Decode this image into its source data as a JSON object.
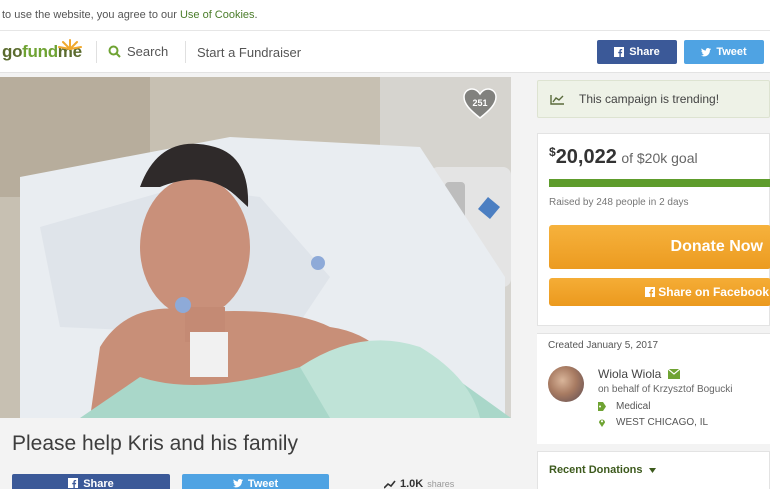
{
  "cookie_bar": {
    "text": "to use the website, you agree to our ",
    "link": "Use of Cookies",
    "period": "."
  },
  "header": {
    "logo_go": "go",
    "logo_fund": "fund",
    "logo_me": "me",
    "search_label": "Search",
    "start_label": "Start a Fundraiser",
    "share_label": "Share",
    "tweet_label": "Tweet"
  },
  "campaign": {
    "heart_count": "251",
    "title": "Please help Kris and his family",
    "share_label": "Share",
    "tweet_label": "Tweet",
    "shares_count": "1.0K",
    "shares_label": "shares"
  },
  "sidebar": {
    "trending": "This campaign is trending!",
    "currency": "$",
    "raised": "20,022",
    "goal": "of $20k goal",
    "progress_fraction": 1.0,
    "raised_by": "Raised by 248 people in 2 days",
    "donate_label": "Donate Now",
    "fb_share_label": "Share on Facebook",
    "created": "Created January 5, 2017",
    "organizer": "Wiola Wiola",
    "behalf": "on behalf of Krzysztof Bogucki",
    "category": "Medical",
    "location": "WEST CHICAGO, IL",
    "recent_donations": "Recent Donations"
  },
  "colors": {
    "brand_green": "#6fa333",
    "facebook": "#3b5998",
    "twitter": "#4fa3e3",
    "donate_orange": "#ec9b20"
  }
}
